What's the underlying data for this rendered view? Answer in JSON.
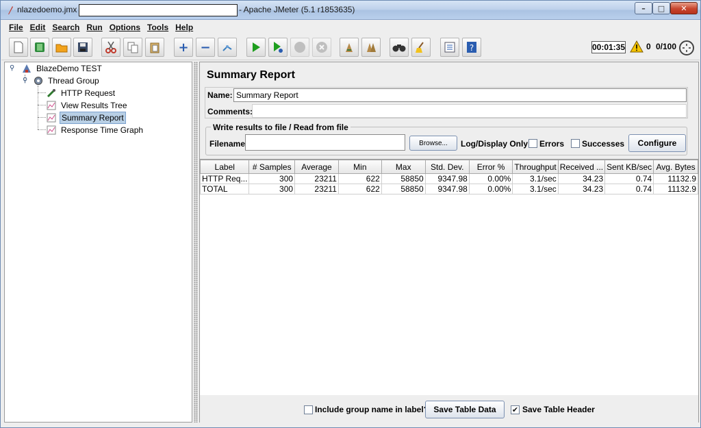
{
  "window": {
    "title_file": "nlazedoemo.jmx",
    "title_app": "- Apache JMeter (5.1 r1853635)",
    "minimize": "–",
    "maximize": "□",
    "close": "✕"
  },
  "menu": [
    "File",
    "Edit",
    "Search",
    "Run",
    "Options",
    "Tools",
    "Help"
  ],
  "toolbar": {
    "timer": "00:01:35",
    "error_count": "0",
    "threads": "0/100"
  },
  "tree": {
    "root": "BlazeDemo TEST",
    "thread_group": "Thread Group",
    "children": [
      "HTTP Request",
      "View Results Tree",
      "Summary Report",
      "Response Time Graph"
    ],
    "selected": "Summary Report"
  },
  "panel": {
    "title": "Summary Report",
    "name_label": "Name:",
    "name_value": "Summary Report",
    "comments_label": "Comments:",
    "comments_value": "",
    "file_legend": "Write results to file / Read from file",
    "filename_label": "Filename",
    "filename_value": "",
    "browse": "Browse...",
    "log_display": "Log/Display Only:",
    "errors": "Errors",
    "successes": "Successes",
    "configure": "Configure"
  },
  "table": {
    "headers": [
      "Label",
      "# Samples",
      "Average",
      "Min",
      "Max",
      "Std. Dev.",
      "Error %",
      "Throughput",
      "Received ...",
      "Sent KB/sec",
      "Avg. Bytes"
    ],
    "rows": [
      [
        "HTTP Req...",
        "300",
        "23211",
        "622",
        "58850",
        "9347.98",
        "0.00%",
        "3.1/sec",
        "34.23",
        "0.74",
        "11132.9"
      ],
      [
        "TOTAL",
        "300",
        "23211",
        "622",
        "58850",
        "9347.98",
        "0.00%",
        "3.1/sec",
        "34.23",
        "0.74",
        "11132.9"
      ]
    ]
  },
  "footer": {
    "include_group": "Include group name in label?",
    "include_group_checked": false,
    "save_table_data": "Save Table Data",
    "save_table_header": "Save Table Header",
    "save_table_header_checked": true
  },
  "colors": {
    "selection": "#b8cfe5",
    "window_bg": "#eeeeee",
    "run_green": "#1e9e1e",
    "warning_yellow": "#f5c400"
  }
}
